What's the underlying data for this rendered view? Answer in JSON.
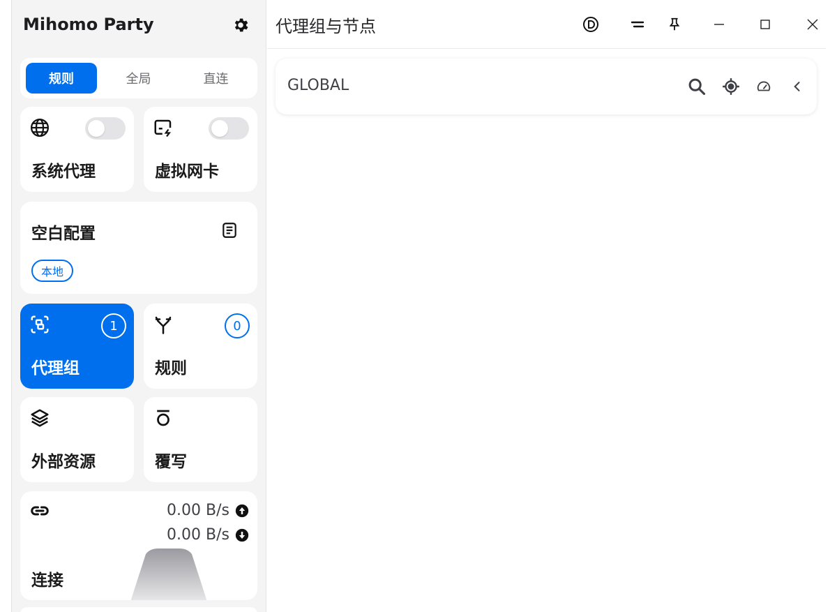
{
  "app": {
    "name": "Mihomo Party"
  },
  "mode_tabs": [
    {
      "label": "规则",
      "active": true
    },
    {
      "label": "全局",
      "active": false
    },
    {
      "label": "直连",
      "active": false
    }
  ],
  "cards": {
    "system_proxy": {
      "label": "系统代理",
      "icon": "globe-icon",
      "enabled": false
    },
    "virtual_nic": {
      "label": "虚拟网卡",
      "icon": "tun-icon",
      "enabled": false
    },
    "profile": {
      "label": "空白配置",
      "icon": "file-text-icon",
      "tag": "本地"
    },
    "proxy_groups": {
      "label": "代理组",
      "icon": "proxy-group-icon",
      "count": "1",
      "active": true
    },
    "rules": {
      "label": "规则",
      "icon": "fork-icon",
      "count": "0",
      "active": false
    },
    "resources": {
      "label": "外部资源",
      "icon": "layers-icon"
    },
    "override": {
      "label": "覆写",
      "icon": "override-icon"
    },
    "connections": {
      "label": "连接",
      "icon": "link-icon",
      "upload": "0.00 B/s",
      "download": "0.00 B/s"
    }
  },
  "main": {
    "title": "代理组与节点",
    "group": {
      "name": "GLOBAL"
    }
  },
  "colors": {
    "accent": "#006fee",
    "sidebar_bg": "#f4f4f5"
  }
}
